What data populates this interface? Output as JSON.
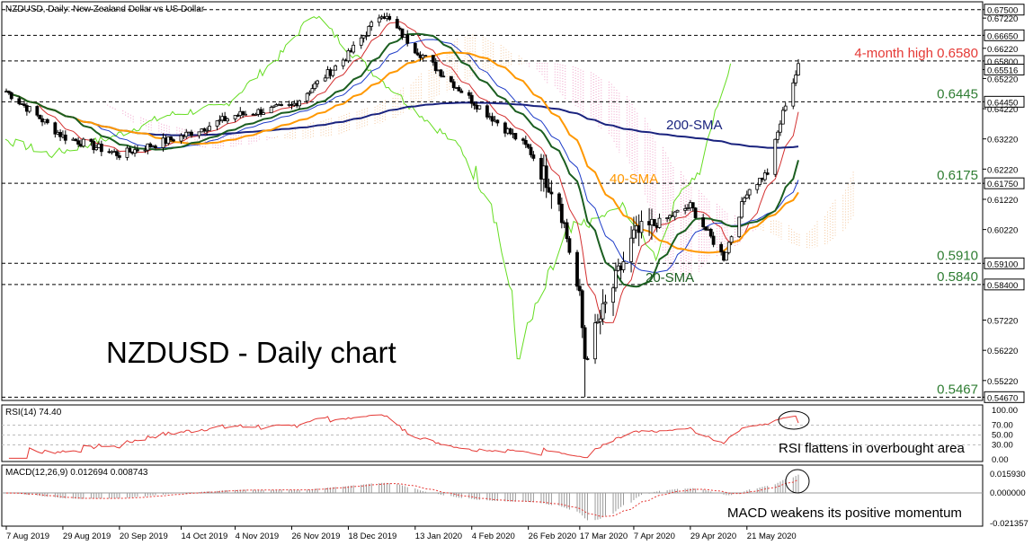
{
  "window": {
    "main_title": "NZDUSD, Daily:  New Zealand Dollar vs US Dollar",
    "rsi_title": "RSI(14) 74.40",
    "macd_title": "MACD(12,26,9) 0.012694 0.008743"
  },
  "chart_data": [
    {
      "type": "candlestick",
      "title": "NZDUSD - Daily chart",
      "ylim": [
        0.5462,
        0.677
      ],
      "price_ticks": [
        "0.67500",
        "0.67220",
        "0.66650",
        "0.66220",
        "0.65800",
        "0.65516",
        "0.65220",
        "0.64450",
        "0.64220",
        "0.63220",
        "0.62220",
        "0.61750",
        "0.61220",
        "0.60220",
        "0.59100",
        "0.58400",
        "0.57220",
        "0.56220",
        "0.55220",
        "0.54670"
      ],
      "x_ticks": [
        "7 Aug 2019",
        "29 Aug 2019",
        "20 Sep 2019",
        "14 Oct 2019",
        "4 Nov 2019",
        "26 Nov 2019",
        "18 Dec 2019",
        "13 Jan 2020",
        "4 Feb 2020",
        "26 Feb 2020",
        "17 Mar 2020",
        "7 Apr 2020",
        "29 Apr 2020",
        "21 May 2020"
      ],
      "levels": [
        {
          "value": 0.675,
          "label": ""
        },
        {
          "value": 0.6665,
          "label": ""
        },
        {
          "value": 0.658,
          "label": "4-month high 0.6580"
        },
        {
          "value": 0.6445,
          "label": "0.6445"
        },
        {
          "value": 0.6175,
          "label": "0.6175"
        },
        {
          "value": 0.591,
          "label": "0.5910"
        },
        {
          "value": 0.584,
          "label": "0.5840"
        },
        {
          "value": 0.5467,
          "label": "0.5467"
        }
      ],
      "series_labels": [
        {
          "name": "200-SMA",
          "color": "#1a237e"
        },
        {
          "name": "40-SMA",
          "color": "#ff9800"
        },
        {
          "name": "20-SMA",
          "color": "#1b5e20"
        }
      ],
      "price_anchors": [
        {
          "date": "7 Aug 2019",
          "close": 0.648
        },
        {
          "date": "29 Aug 2019",
          "close": 0.633
        },
        {
          "date": "20 Sep 2019",
          "close": 0.627
        },
        {
          "date": "14 Oct 2019",
          "close": 0.633
        },
        {
          "date": "4 Nov 2019",
          "close": 0.64
        },
        {
          "date": "26 Nov 2019",
          "close": 0.643
        },
        {
          "date": "18 Dec 2019",
          "close": 0.66
        },
        {
          "date": "31 Dec 2019",
          "close": 0.674
        },
        {
          "date": "13 Jan 2020",
          "close": 0.662
        },
        {
          "date": "4 Feb 2020",
          "close": 0.645
        },
        {
          "date": "26 Feb 2020",
          "close": 0.629
        },
        {
          "date": "9 Mar 2020",
          "close": 0.612
        },
        {
          "date": "17 Mar 2020",
          "close": 0.579
        },
        {
          "date": "19 Mar 2020",
          "close": 0.56
        },
        {
          "date": "7 Apr 2020",
          "close": 0.6
        },
        {
          "date": "29 Apr 2020",
          "close": 0.61
        },
        {
          "date": "12 May 2020",
          "close": 0.593
        },
        {
          "date": "21 May 2020",
          "close": 0.615
        },
        {
          "date": "29 May 2020",
          "close": 0.621
        },
        {
          "date": "5 Jun 2020",
          "close": 0.644
        },
        {
          "date": "10 Jun 2020",
          "close": 0.656
        }
      ],
      "annotations": {
        "source_note": ""
      }
    },
    {
      "type": "line",
      "title": "RSI(14) 74.40",
      "ylim": [
        0,
        100
      ],
      "ticks": [
        "100.00",
        "70.00",
        "50.00",
        "30.00",
        "0.00"
      ],
      "last_value": 74.4,
      "annotation": "RSI flattens in overbought area"
    },
    {
      "type": "bar",
      "title": "MACD(12,26,9) 0.012694 0.008743",
      "ticks": [
        "0.015930",
        "0.000000",
        "-0.021357"
      ],
      "ylim": [
        -0.021357,
        0.01593
      ],
      "macd": 0.012694,
      "signal": 0.008743,
      "annotation": "MACD weakens its positive momentum"
    }
  ]
}
